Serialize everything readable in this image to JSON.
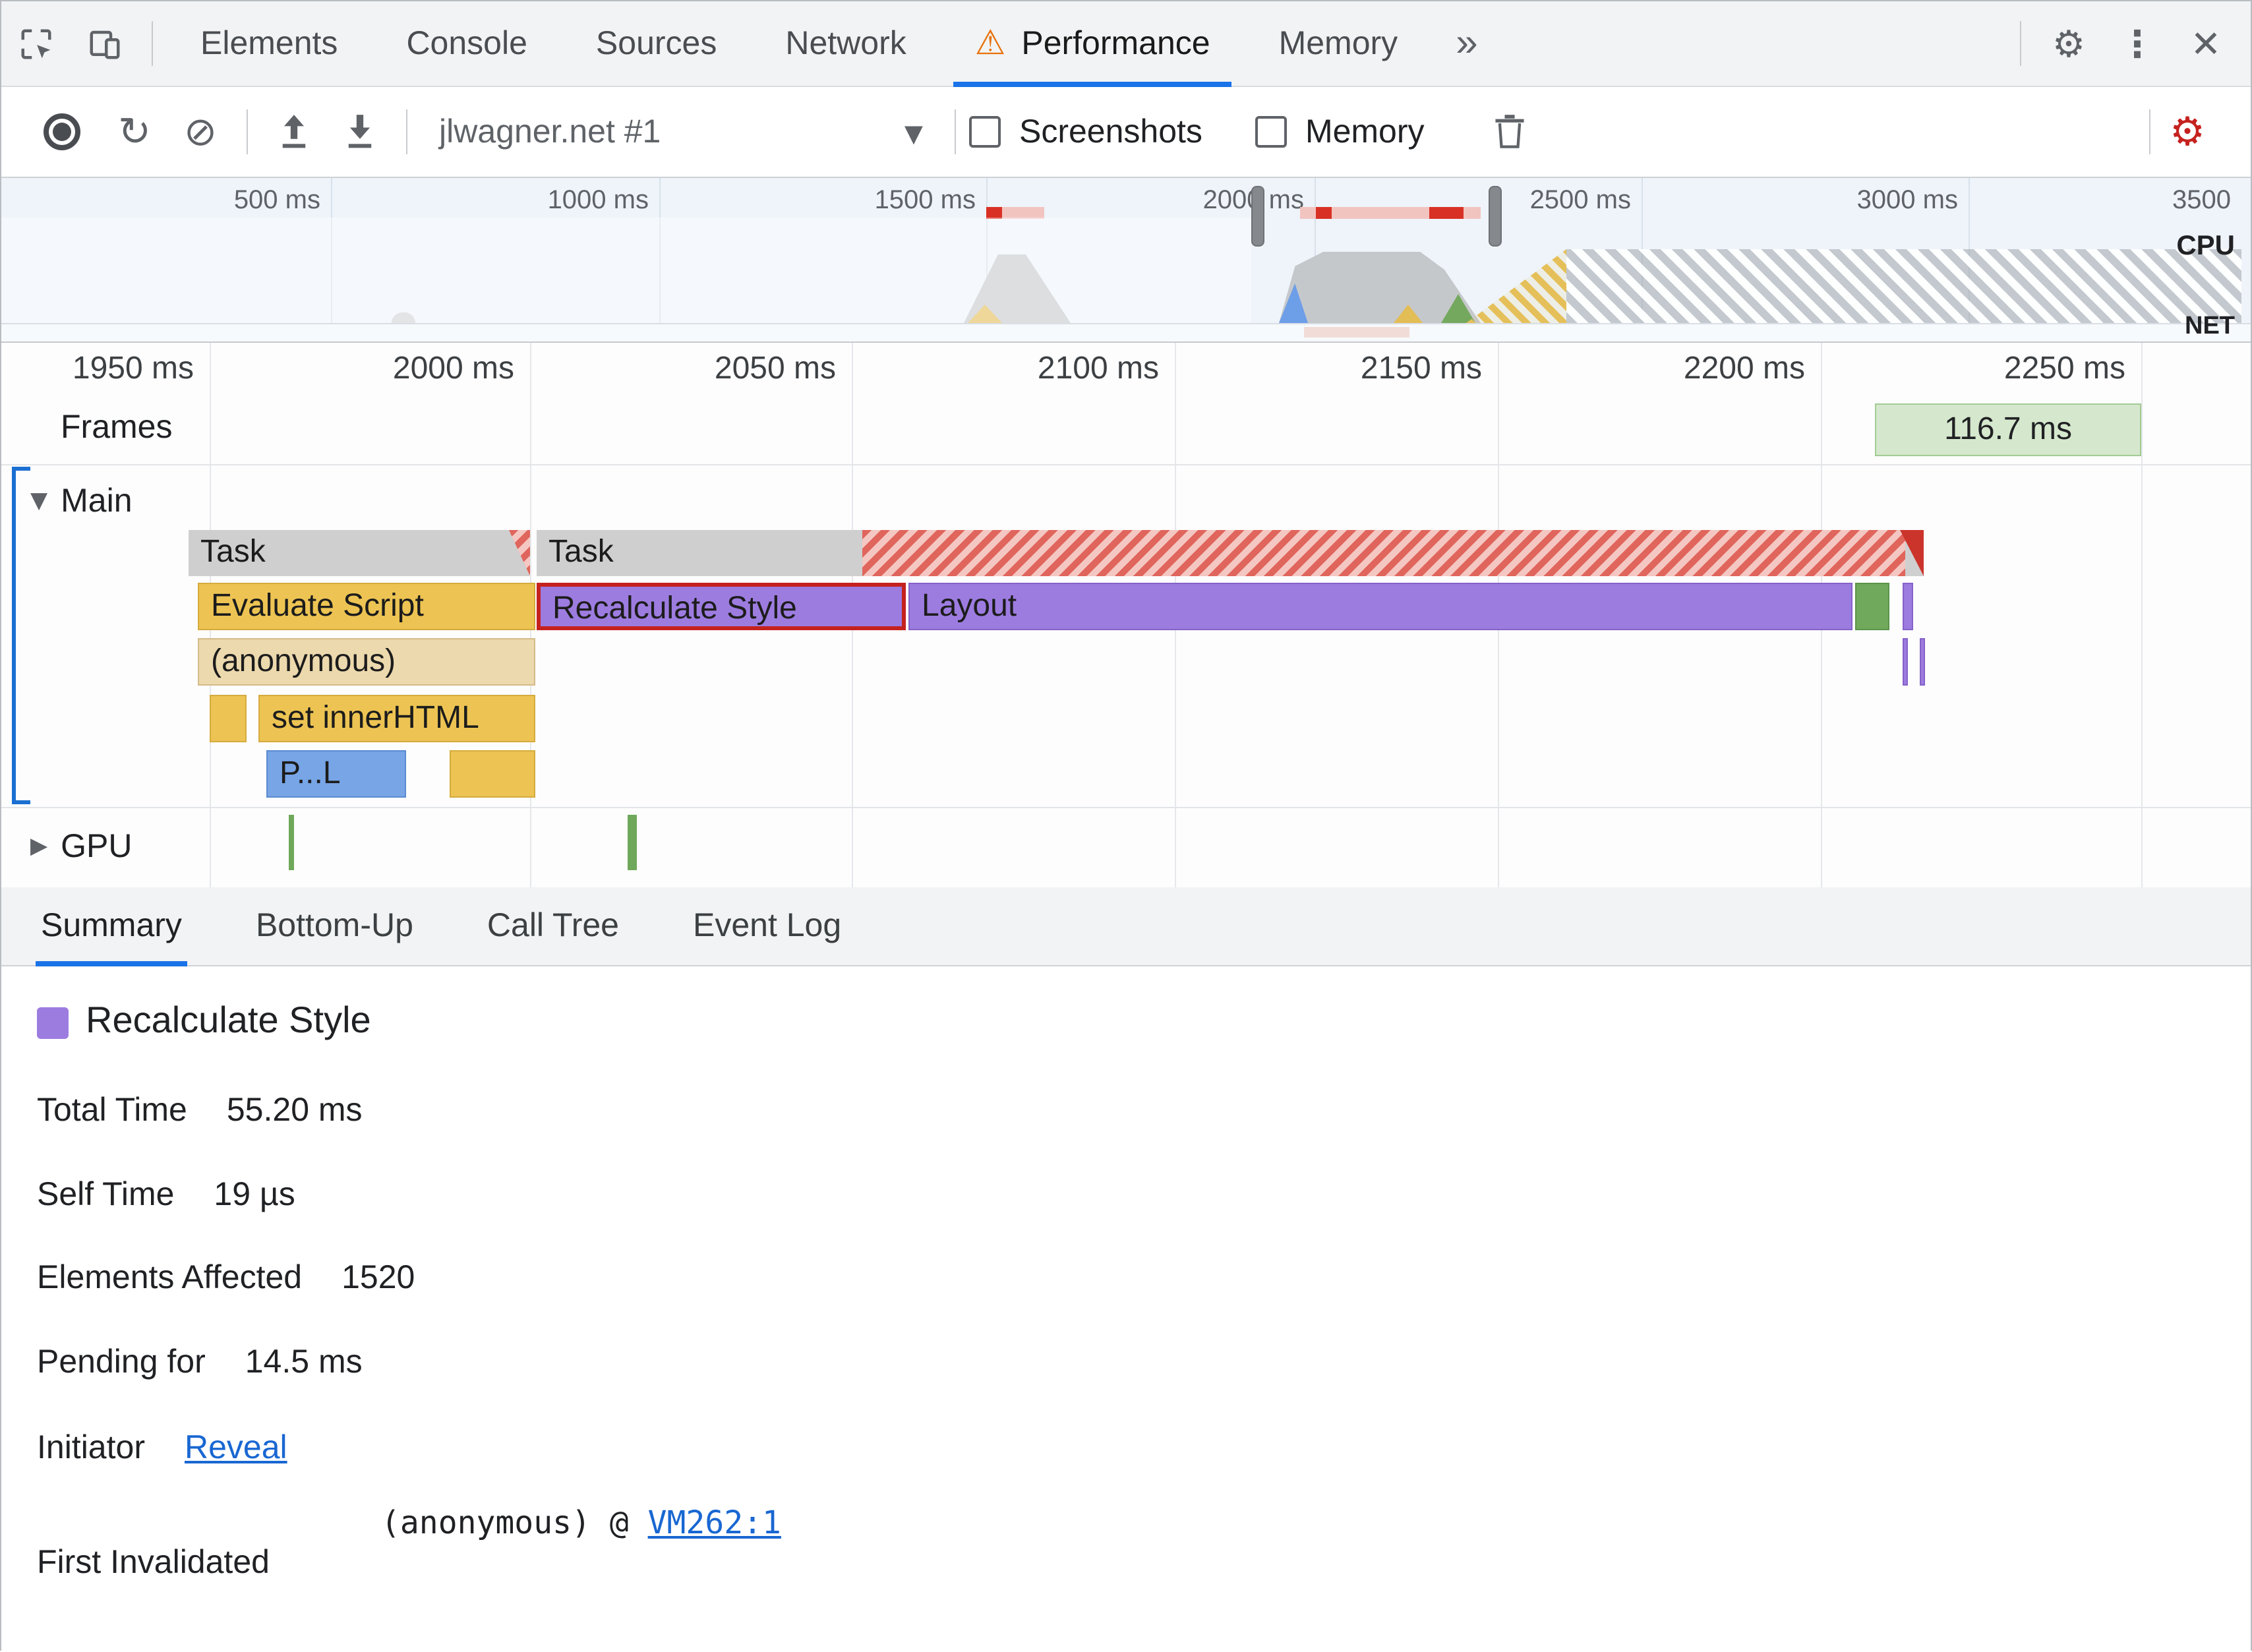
{
  "icons": {
    "warning": "⚠",
    "settings": "⚙",
    "overflow": "⋮",
    "close": "✕",
    "reload": "↻",
    "clear": "⊘",
    "dropdown": "▾",
    "expanded": "▼",
    "collapsed": "▶",
    "more_tabs": "»"
  },
  "devtools_tabs": {
    "tabs": [
      {
        "label": "Elements"
      },
      {
        "label": "Console"
      },
      {
        "label": "Sources"
      },
      {
        "label": "Network"
      },
      {
        "label": "Performance",
        "active": true,
        "warning": true
      },
      {
        "label": "Memory"
      }
    ]
  },
  "perf_toolbar": {
    "profile_name": "jlwagner.net #1",
    "screenshots": {
      "label": "Screenshots",
      "checked": false
    },
    "memory": {
      "label": "Memory",
      "checked": false
    }
  },
  "overview": {
    "ticks": [
      "500 ms",
      "1000 ms",
      "1500 ms",
      "2000 ms",
      "2500 ms",
      "3000 ms",
      "3500"
    ],
    "cpu_label": "CPU",
    "net_label": "NET"
  },
  "timeline": {
    "ticks": [
      "1950 ms",
      "2000 ms",
      "2050 ms",
      "2100 ms",
      "2150 ms",
      "2200 ms",
      "2250 ms"
    ],
    "frames_label": "Frames",
    "frame_duration": "116.7 ms",
    "main_label": "Main",
    "gpu_label": "GPU",
    "events": {
      "task": "Task",
      "evaluate_script": "Evaluate Script",
      "recalculate_style": "Recalculate Style",
      "layout": "Layout",
      "anonymous": "(anonymous)",
      "set_inner_html": "set innerHTML",
      "parse_truncated": "P...L"
    }
  },
  "bottom_tabs": [
    "Summary",
    "Bottom-Up",
    "Call Tree",
    "Event Log"
  ],
  "summary": {
    "title": "Recalculate Style",
    "stats": [
      {
        "label": "Total Time",
        "value": "55.20 ms"
      },
      {
        "label": "Self Time",
        "value": "19 µs"
      },
      {
        "label": "Elements Affected",
        "value": "1520"
      },
      {
        "label": "Pending for",
        "value": "14.5 ms"
      }
    ],
    "initiator": {
      "label": "Initiator",
      "link": "Reveal"
    },
    "first_invalidated": {
      "label": "First Invalidated",
      "value": "(anonymous) @",
      "link": "VM262:1"
    }
  },
  "colors": {
    "accent_blue": "#1a73e8",
    "link_blue": "#1967d2",
    "warning_orange": "#e8710a",
    "toolbar_gear_red": "#c5221f",
    "task_gray": "#cfcfcf",
    "scripting_yellow": "#edc453",
    "rendering_purple": "#9d7ce0",
    "painting_green": "#71a95c",
    "loading_blue": "#77a5e6",
    "function_tan": "#ecd9ad",
    "long_task_red": "#cb342b",
    "selection_outline_red": "#c5221f",
    "frame_green": "#d5e8cd"
  }
}
